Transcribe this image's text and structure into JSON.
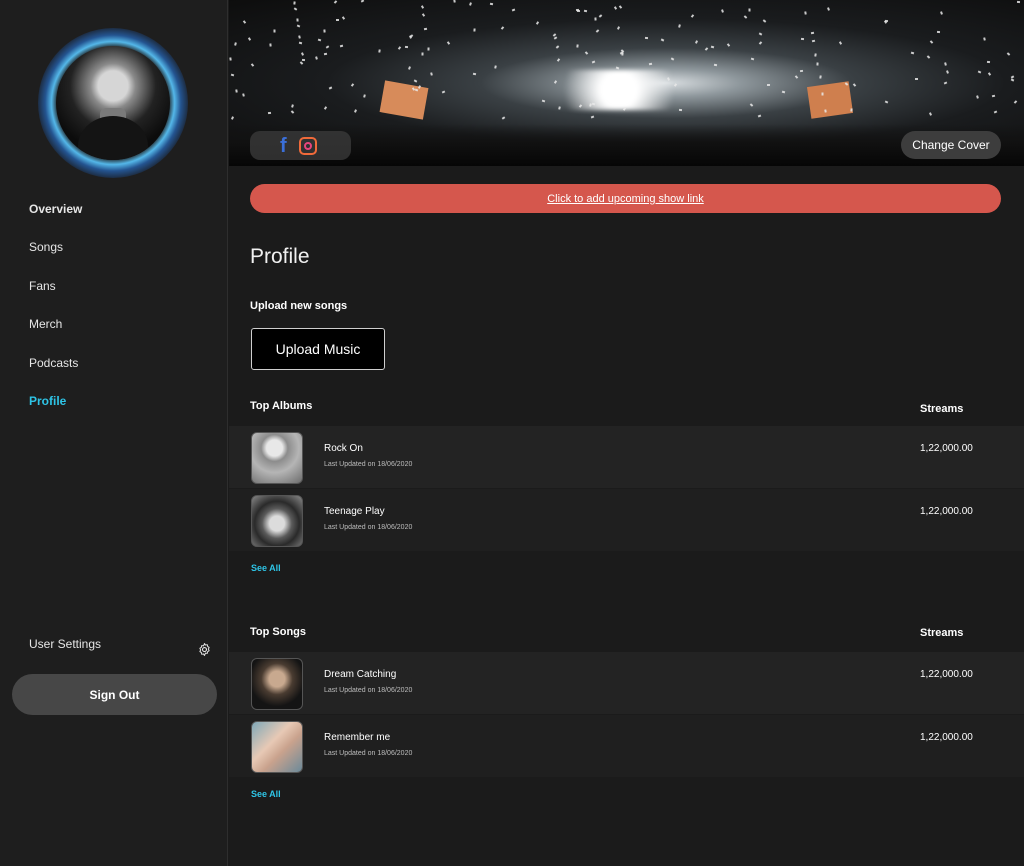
{
  "sidebar": {
    "nav": [
      {
        "label": "Overview"
      },
      {
        "label": "Songs"
      },
      {
        "label": "Fans"
      },
      {
        "label": "Merch"
      },
      {
        "label": "Podcasts"
      },
      {
        "label": "Profile"
      }
    ],
    "active_item": "Profile",
    "user_settings": "User Settings",
    "sign_out": "Sign Out"
  },
  "cover": {
    "change_cover": "Change Cover",
    "social_icons": [
      "facebook-icon",
      "instagram-icon"
    ]
  },
  "banner": {
    "show_link": "Click to add upcoming show link"
  },
  "profile": {
    "title": "Profile",
    "upload_label": "Upload new songs",
    "upload_button": "Upload Music"
  },
  "top_albums": {
    "title": "Top Albums",
    "streams_header": "Streams",
    "items": [
      {
        "title": "Rock On",
        "updated": "Last Updated on 18/06/2020",
        "streams": "1,22,000.00"
      },
      {
        "title": "Teenage Play",
        "updated": "Last Updated on 18/06/2020",
        "streams": "1,22,000.00"
      }
    ],
    "see_all": "See All"
  },
  "top_songs": {
    "title": "Top Songs",
    "streams_header": "Streams",
    "items": [
      {
        "title": "Dream Catching",
        "updated": "Last Updated on 18/06/2020",
        "streams": "1,22,000.00"
      },
      {
        "title": "Remember me",
        "updated": "Last Updated on 18/06/2020",
        "streams": "1,22,000.00"
      }
    ],
    "see_all": "See All"
  },
  "colors": {
    "accent": "#2ec4e6",
    "banner": "#d5574d",
    "background": "#1b1b1b",
    "sidebar": "#1e1e1e"
  }
}
